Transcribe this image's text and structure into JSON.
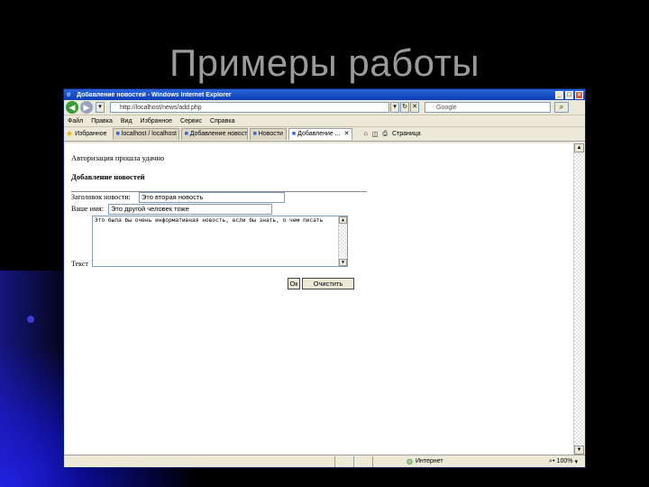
{
  "slide": {
    "title": "Примеры работы"
  },
  "browser": {
    "window_title": "Добавление новостей - Windows Internet Explorer",
    "address": "http://localhost/news/add.php",
    "search_placeholder": "Google",
    "menu": [
      "Файл",
      "Правка",
      "Вид",
      "Избранное",
      "Сервис",
      "Справка"
    ],
    "favorites_label": "Избранное",
    "tabs": [
      {
        "label": "localhost / localhost ...",
        "active": false
      },
      {
        "label": "Добавление новост...",
        "active": false
      },
      {
        "label": "Новости",
        "active": false
      },
      {
        "label": "Добавление ...",
        "active": true
      }
    ],
    "tools": [
      "Страница"
    ],
    "status": {
      "zone": "Интернет",
      "zoom": "100%"
    }
  },
  "page": {
    "auth_message": "Авторизация прошла удачно",
    "section_title": "Добавление новостей",
    "labels": {
      "title": "Заголовок новости:",
      "name": "Ваше имя:",
      "text": "Текст"
    },
    "fields": {
      "title_value": "Это вторая новость",
      "name_value": "Это другой человек тоже",
      "text_value": "Это была бы очень информативная новость, если бы знать, о чем писать"
    },
    "buttons": {
      "ok": "Ок",
      "clear": "Очистить"
    }
  },
  "colors": {
    "titlebar": "#0c3db5",
    "chrome": "#ece9d8",
    "slide_accent": "#1a1ad8",
    "slide_title": "#9a9a9a"
  }
}
